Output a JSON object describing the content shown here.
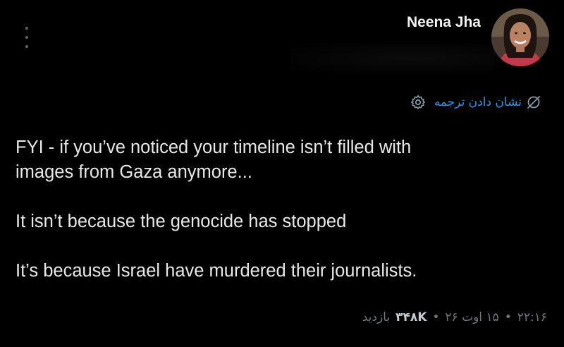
{
  "author": {
    "name": "Neena Jha"
  },
  "translate": {
    "label": "نشان دادن ترجمه"
  },
  "tweet": {
    "line1": "FYI - if you’ve noticed your timeline isn’t filled with",
    "line2": "images from Gaza anymore...",
    "line3": "It isn’t because the genocide has stopped",
    "line4": "It’s because Israel have murdered their journalists."
  },
  "meta": {
    "time": "۲۲:۱۶",
    "date": "۱۵ اوت ۲۶",
    "views_count": "۳۴۸K",
    "views_label": "بازدید",
    "separator": "•"
  },
  "colors": {
    "background": "#000000",
    "accent": "#1d9bf0",
    "muted": "#71767b",
    "text": "#e7e9ea"
  },
  "icons": {
    "more": "vertical-dots-icon",
    "settings": "gear-icon",
    "translate": "globe-slash-icon",
    "avatar": "profile-photo"
  }
}
